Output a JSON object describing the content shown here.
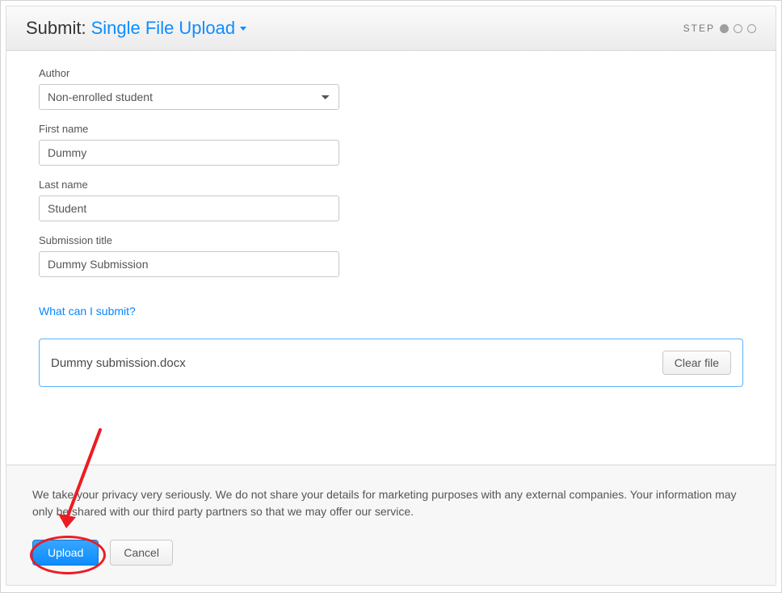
{
  "header": {
    "prefix": "Submit:",
    "mode": "Single File Upload",
    "step_label": "STEP"
  },
  "fields": {
    "author": {
      "label": "Author",
      "value": "Non-enrolled student"
    },
    "first_name": {
      "label": "First name",
      "value": "Dummy"
    },
    "last_name": {
      "label": "Last name",
      "value": "Student"
    },
    "title": {
      "label": "Submission title",
      "value": "Dummy Submission"
    }
  },
  "links": {
    "what_can_i_submit": "What can I submit?"
  },
  "file": {
    "name": "Dummy submission.docx",
    "clear_label": "Clear file"
  },
  "footer": {
    "privacy": "We take your privacy very seriously. We do not share your details for marketing purposes with any external companies. Your information may only be shared with our third party partners so that we may offer our service.",
    "upload_label": "Upload",
    "cancel_label": "Cancel"
  },
  "colors": {
    "accent": "#0d8cff",
    "highlight": "#ec1c24"
  }
}
